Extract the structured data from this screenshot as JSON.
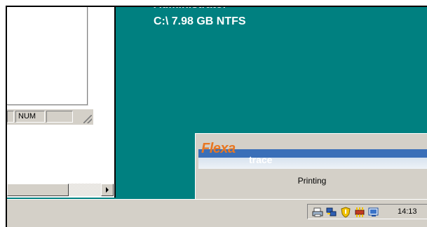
{
  "desktop": {
    "user_label": "Administrator",
    "drive_info": "C:\\ 7.98 GB NTFS"
  },
  "window": {
    "status_cells": [
      "",
      "NUM",
      ""
    ]
  },
  "splash": {
    "logo_primary": "Flexa",
    "logo_secondary": "trace",
    "status": "Printing"
  },
  "taskbar": {
    "tray_icons": [
      "printer-icon",
      "network-icon",
      "security-shield-icon",
      "hardware-icon",
      "display-icon"
    ],
    "clock": "14:13"
  }
}
